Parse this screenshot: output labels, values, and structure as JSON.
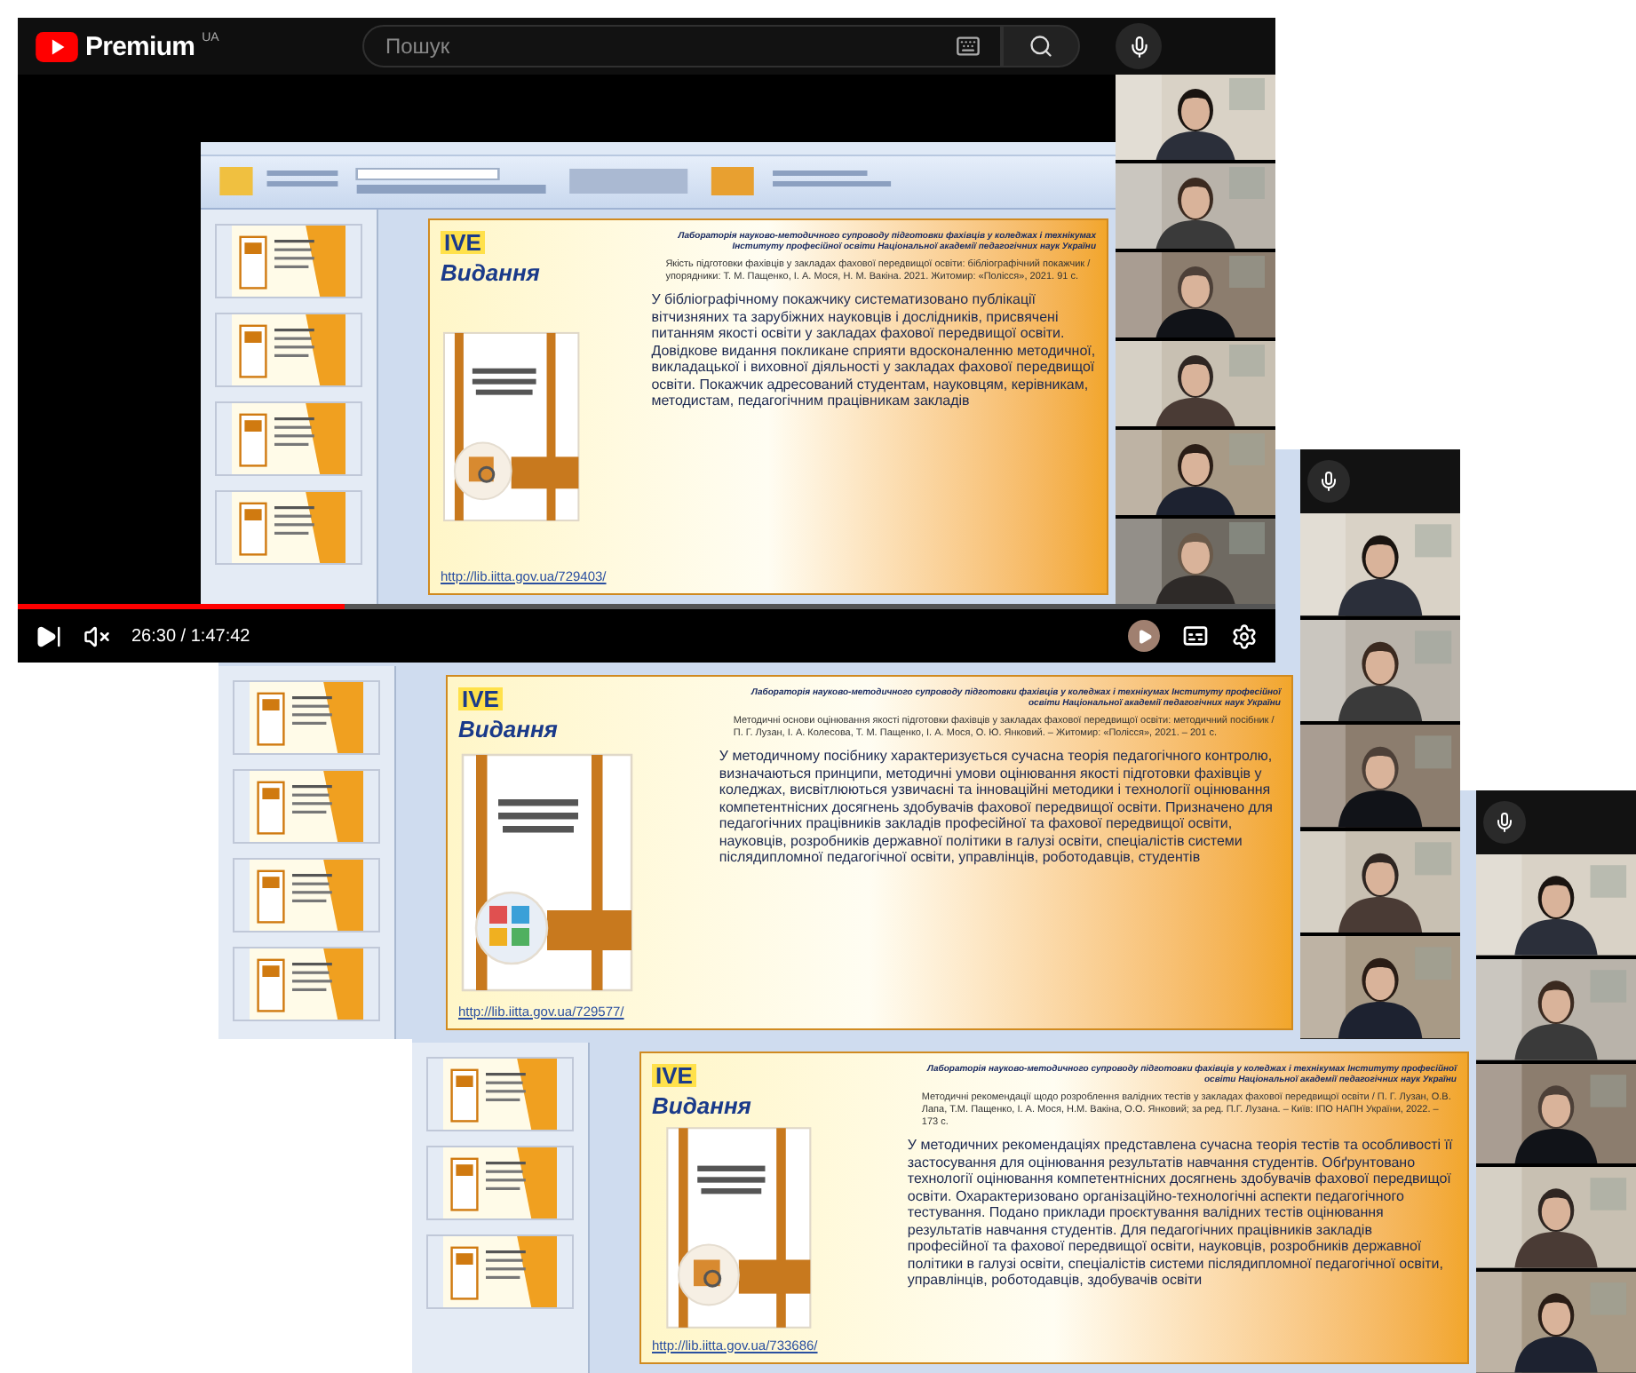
{
  "youtube": {
    "brand": "Premium",
    "region": "UA",
    "search": {
      "placeholder": "Пошук"
    },
    "time": "26:30 / 1:47:42",
    "progress": {
      "level": 0.26
    }
  },
  "recordings": [
    {
      "slide": {
        "logo": "IVE",
        "lab": "Лабораторія науково-методичного супроводу підготовки фахівців у коледжах і технікумах Інституту професійної освіти Національної академії педагогічних наук України",
        "title": "Видання",
        "citation": "Якість підготовки фахівців у закладах фахової передвищої освіти: бібліографічний покажчик / упорядники: Т. М. Пащенко, І. А. Мося, Н. М. Вакіна. 2021. Житомир: «Полісся», 2021. 91 с.",
        "body": "У бібліографічному покажчику систематизовано публікації вітчизняних та зарубіжних науковців і дослідників, присвячені питанням якості освіти у закладах фахової передвищої освіти. Довідкове видання покликане сприяти вдосконаленню методичної, викладацької і виховної діяльності у закладах фахової передвищої освіти. Покажчик адресований студентам, науковцям, керівникам, методистам, педагогічним працівникам закладів",
        "link": "http://lib.iitta.gov.ua/729403/"
      }
    },
    {
      "slide": {
        "logo": "IVE",
        "lab": "Лабораторія науково-методичного супроводу підготовки фахівців у коледжах і технікумах Інституту професійної освіти Національної академії педагогічних наук України",
        "title": "Видання",
        "citation": "Методичні основи оцінювання якості підготовки фахівців у закладах фахової передвищої освіти: методичний посібник / П. Г. Лузан, І. А. Колесова, Т. М. Пащенко, І. А. Мося, О. Ю. Янковий. – Житомир: «Полісся», 2021. – 201 с.",
        "body": "У методичному посібнику характеризується сучасна теорія педагогічного контролю, визначаються принципи, методичні умови оцінювання якості підготовки фахівців у коледжах, висвітлюються узвичаєні та інноваційні методики і технології оцінювання компетентнісних досягнень здобувачів фахової передвищої освіти. Призначено для педагогічних працівників закладів професійної та фахової передвищої освіти, науковців, розробників державної політики в галузі освіти, спеціалістів системи післядипломної педагогічної освіти, управлінців, роботодавців, студентів",
        "link": "http://lib.iitta.gov.ua/729577/"
      }
    },
    {
      "slide": {
        "logo": "IVE",
        "lab": "Лабораторія науково-методичного супроводу підготовки фахівців у коледжах і технікумах Інституту професійної освіти Національної академії педагогічних наук України",
        "title": "Видання",
        "citation": "Методичні рекомендації щодо розроблення валідних тестів у закладах фахової передвищої освіти / П. Г. Лузан, О.В. Лапа, Т.М. Пащенко, І. А. Мося, Н.М. Вакіна, О.О. Янковий; за ред. П.Г. Лузана. – Київ: ІПО НАПН України, 2022. – 173 с.",
        "body": "У методичних рекомендаціях представлена сучасна теорія тестів та особливості її застосування для оцінювання результатів навчання студентів. Обґрунтовано технології оцінювання компетентнісних досягнень здобувачів фахової передвищої освіти. Охарактеризовано організаційно-технологічні аспекти педагогічного тестування. Подано приклади проєктування валідних тестів оцінювання результатів навчання студентів. Для педагогічних працівників закладів професійної та фахової передвищої освіти, науковців, розробників державної політики в галузі освіти, спеціалістів системи післядипломної педагогічної освіти, управлінців, роботодавців, здобувачів освіти",
        "link": "http://lib.iitta.gov.ua/733686/"
      }
    }
  ]
}
